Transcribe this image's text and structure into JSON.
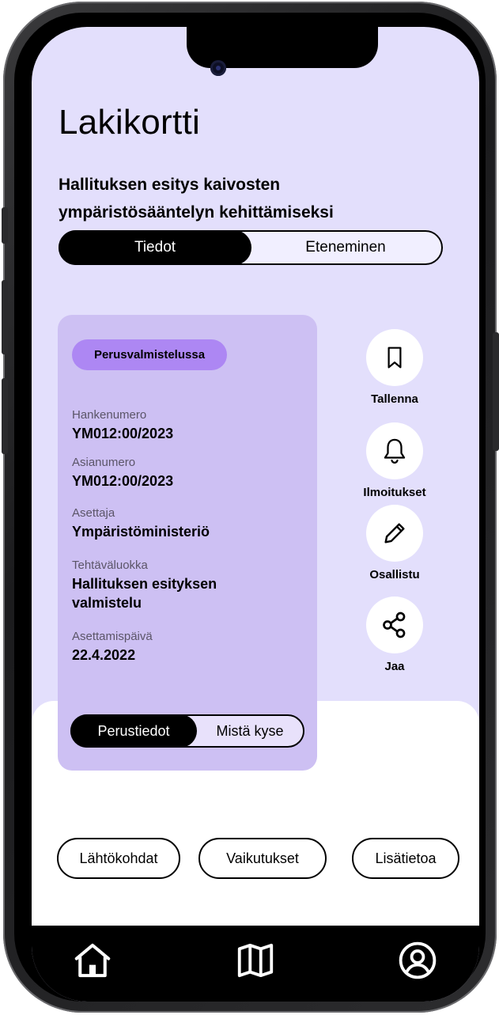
{
  "app": {
    "title": "Lakikortti"
  },
  "law": {
    "title": "Hallituksen esitys kaivosten ympäristösääntelyn kehittämiseksi"
  },
  "main_tabs": [
    {
      "label": "Tiedot",
      "active": true
    },
    {
      "label": "Eteneminen",
      "active": false
    }
  ],
  "card": {
    "status": "Perusvalmistelussa",
    "fields": [
      {
        "label": "Hankenumero",
        "value": "YM012:00/2023"
      },
      {
        "label": "Asianumero",
        "value": "YM012:00/2023"
      },
      {
        "label": "Asettaja",
        "value": "Ympäristöministeriö"
      },
      {
        "label": "Tehtäväluokka",
        "value": "Hallituksen esityksen valmistelu"
      },
      {
        "label": "Asettamispäivä",
        "value": "22.4.2022"
      }
    ],
    "tabs": [
      {
        "label": "Perustiedot",
        "active": true
      },
      {
        "label": "Mistä kyse",
        "active": false
      }
    ]
  },
  "actions": [
    {
      "label": "Tallenna",
      "icon": "bookmark-icon"
    },
    {
      "label": "Ilmoitukset",
      "icon": "bell-icon"
    },
    {
      "label": "Osallistu",
      "icon": "pencil-icon"
    },
    {
      "label": "Jaa",
      "icon": "share-icon"
    }
  ],
  "section_buttons": [
    {
      "label": "Lähtökohdat"
    },
    {
      "label": "Vaikutukset"
    },
    {
      "label": "Lisätietoa"
    }
  ],
  "nav": [
    {
      "icon": "home-icon"
    },
    {
      "icon": "map-icon"
    },
    {
      "icon": "profile-icon"
    }
  ],
  "colors": {
    "background": "#e3dffc",
    "card": "#cdc0f3",
    "badge": "#ad87f3",
    "active_segment": "#000000"
  }
}
